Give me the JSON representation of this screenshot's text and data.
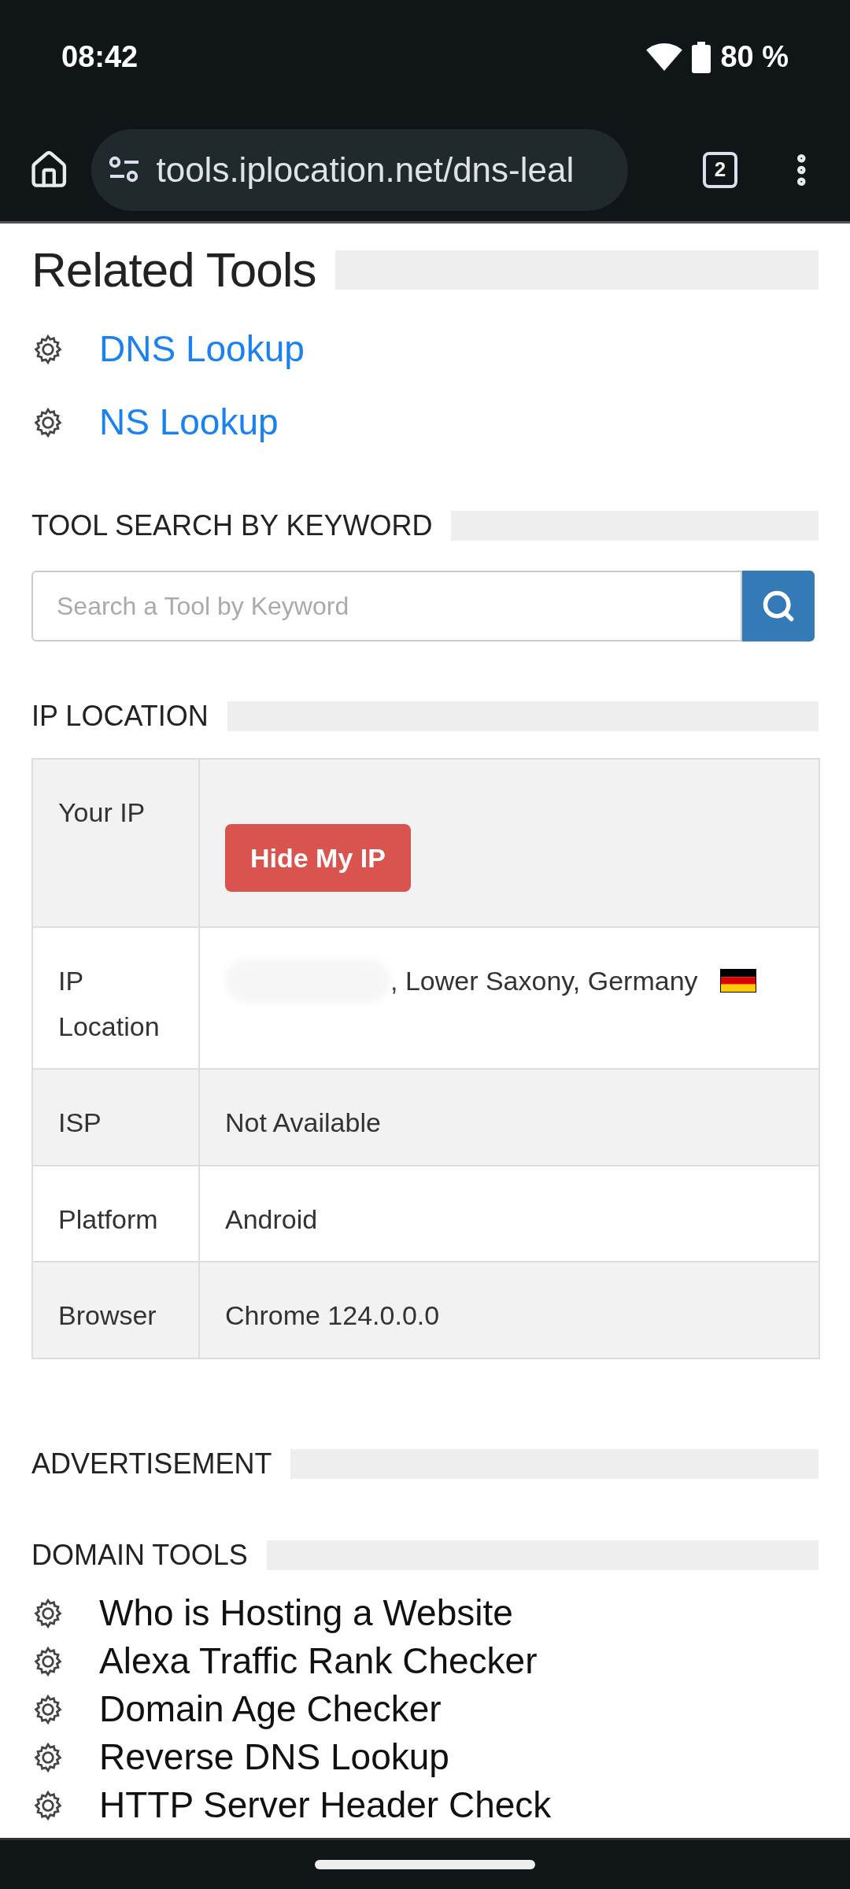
{
  "status_bar": {
    "time": "08:42",
    "battery": "80 %"
  },
  "browser": {
    "url": "tools.iplocation.net/dns-leal",
    "tab_count": "2"
  },
  "related_tools": {
    "title": "Related Tools",
    "items": [
      "DNS Lookup",
      "NS Lookup"
    ]
  },
  "tool_search": {
    "title": "TOOL SEARCH BY KEYWORD",
    "placeholder": "Search a Tool by Keyword"
  },
  "ip_location": {
    "title": "IP LOCATION",
    "rows": [
      {
        "label": "Your IP",
        "kind": "button",
        "button": "Hide My IP"
      },
      {
        "label": "IP Location",
        "kind": "location",
        "value": ", Lower Saxony, Germany"
      },
      {
        "label": "ISP",
        "kind": "text",
        "value": "Not Available"
      },
      {
        "label": "Platform",
        "kind": "text",
        "value": "Android"
      },
      {
        "label": "Browser",
        "kind": "text",
        "value": "Chrome 124.0.0.0"
      }
    ]
  },
  "advertisement": {
    "title": "ADVERTISEMENT"
  },
  "domain_tools": {
    "title": "DOMAIN TOOLS",
    "items": [
      "Who is Hosting a Website",
      "Alexa Traffic Rank Checker",
      "Domain Age Checker",
      "Reverse DNS Lookup",
      "HTTP Server Header Check"
    ]
  }
}
